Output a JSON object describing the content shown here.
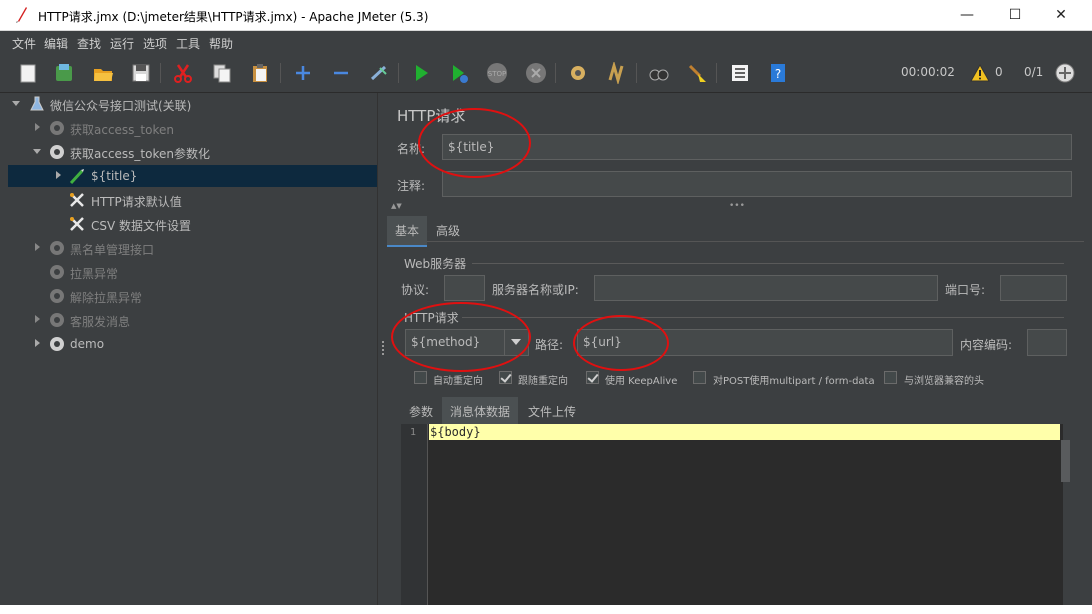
{
  "window": {
    "title": "HTTP请求.jmx (D:\\jmeter结果\\HTTP请求.jmx) - Apache JMeter (5.3)",
    "minimize": "—",
    "maximize": "☐",
    "close": "✕"
  },
  "menu": [
    "文件",
    "编辑",
    "查找",
    "运行",
    "选项",
    "工具",
    "帮助"
  ],
  "toolbar": {
    "timer": "00:00:02",
    "warnings": "0",
    "threads": "0/1"
  },
  "tree": [
    {
      "label": "微信公众号接口测试(关联)",
      "enabled": true
    },
    {
      "label": "获取access_token",
      "enabled": false
    },
    {
      "label": "获取access_token参数化",
      "enabled": true
    },
    {
      "label": "${title}",
      "enabled": true,
      "selected": true
    },
    {
      "label": "HTTP请求默认值",
      "enabled": true
    },
    {
      "label": "CSV 数据文件设置",
      "enabled": true
    },
    {
      "label": "黑名单管理接口",
      "enabled": false
    },
    {
      "label": "拉黑异常",
      "enabled": false
    },
    {
      "label": "解除拉黑异常",
      "enabled": false
    },
    {
      "label": "客服发消息",
      "enabled": false
    },
    {
      "label": "demo",
      "enabled": true
    }
  ],
  "panel": {
    "heading": "HTTP请求",
    "name_label": "名称:",
    "name_value": "${title}",
    "comment_label": "注释:",
    "comment_value": "",
    "tabs": [
      "基本",
      "高级"
    ],
    "web_server": {
      "title": "Web服务器",
      "protocol_label": "协议:",
      "protocol_value": "",
      "server_label": "服务器名称或IP:",
      "server_value": "",
      "port_label": "端口号:",
      "port_value": ""
    },
    "http_request": {
      "title": "HTTP请求",
      "method": "${method}",
      "path_label": "路径:",
      "path_value": "${url}",
      "encoding_label": "内容编码:",
      "encoding_value": ""
    },
    "options": [
      {
        "label": "自动重定向",
        "checked": false
      },
      {
        "label": "跟随重定向",
        "checked": true
      },
      {
        "label": "使用 KeepAlive",
        "checked": true
      },
      {
        "label": "对POST使用multipart / form-data",
        "checked": false
      },
      {
        "label": "与浏览器兼容的头",
        "checked": false
      }
    ],
    "body_tabs": [
      "参数",
      "消息体数据",
      "文件上传"
    ],
    "body": {
      "line_number": "1",
      "content": "${body}"
    }
  },
  "colors": {
    "background": "#3c3f41",
    "selection": "#0d293e",
    "highlight": "#ffffaa",
    "annotation": "#e01010"
  }
}
